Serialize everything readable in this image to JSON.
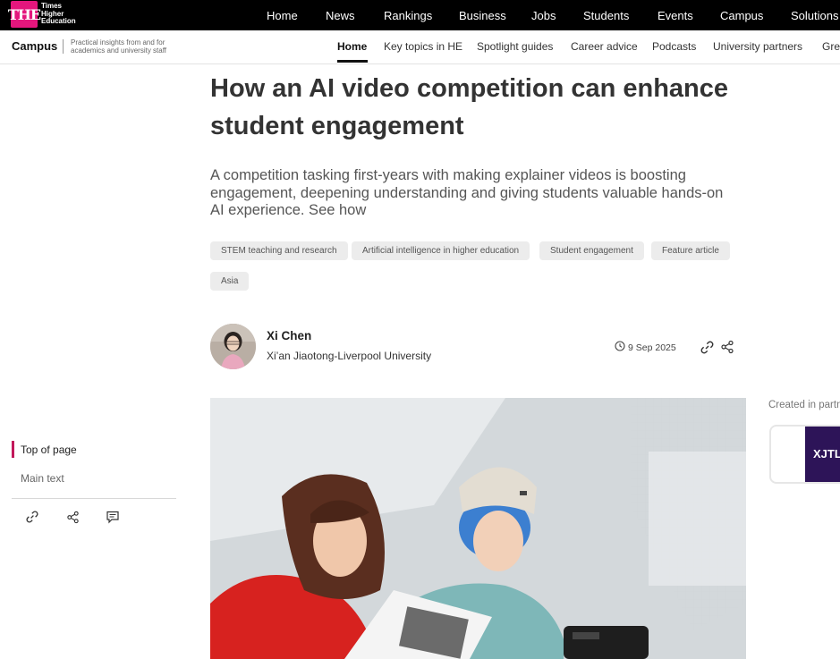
{
  "brand": {
    "logo_mark": "THE",
    "logo_lines": [
      "Times",
      "Higher",
      "Education"
    ]
  },
  "top_nav": [
    "Home",
    "News",
    "Rankings",
    "Business",
    "Jobs",
    "Students",
    "Events",
    "Campus",
    "Solutions"
  ],
  "sub_header": {
    "section": "Campus",
    "tagline": "Practical insights from and for academics and university staff",
    "items": [
      "Home",
      "Key topics in HE",
      "Spotlight guides",
      "Career advice",
      "Podcasts",
      "University partners",
      "Gre"
    ]
  },
  "article": {
    "title_line1": "How an AI video competition can enhance",
    "title_line2": "student engagement",
    "standfirst": "A competition tasking first-years with making explainer videos is boosting engagement, deepening understanding and giving students valuable hands-on AI experience. See how",
    "tags": [
      "STEM teaching and research",
      "Artificial intelligence in higher education",
      "Student engagement",
      "Feature article",
      "Asia"
    ],
    "author": {
      "name": "Xi Chen",
      "institution": "Xi’an Jiaotong-Liverpool University"
    },
    "date": "9 Sep 2025"
  },
  "side_nav": {
    "items": [
      "Top of page",
      "Main text"
    ],
    "active": "Top of page"
  },
  "partner": {
    "label": "Created in partn",
    "logo_text": "XJTL"
  },
  "icons": {
    "link": "link-icon",
    "share": "share-icon",
    "comment": "comment-icon",
    "clock": "clock-icon"
  },
  "colors": {
    "accent": "#c2185b",
    "logo": "#e4167d",
    "topbar": "#000000",
    "partner": "#2d1458"
  }
}
